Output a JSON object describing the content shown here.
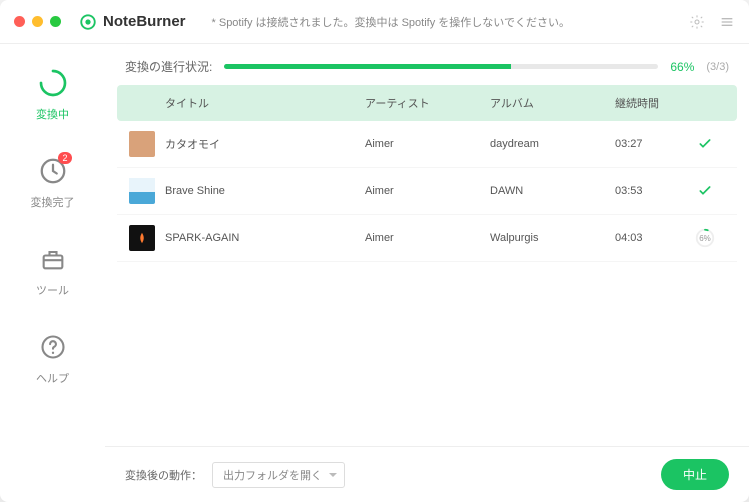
{
  "app": {
    "name": "NoteBurner"
  },
  "statusMessage": "* Spotify は接続されました。変換中は Spotify を操作しないでください。",
  "sidebar": {
    "items": [
      {
        "label": "変換中",
        "icon": "converting",
        "active": true
      },
      {
        "label": "変換完了",
        "icon": "done",
        "badge": "2"
      },
      {
        "label": "ツール",
        "icon": "tools"
      },
      {
        "label": "ヘルプ",
        "icon": "help"
      }
    ]
  },
  "progress": {
    "label": "変換の進行状況:",
    "percent": 66,
    "percentText": "66%",
    "countText": "(3/3)"
  },
  "table": {
    "headers": {
      "title": "タイトル",
      "artist": "アーティスト",
      "album": "アルバム",
      "duration": "継続時間"
    },
    "rows": [
      {
        "title": "カタオモイ",
        "artist": "Aimer",
        "album": "daydream",
        "duration": "03:27",
        "status": "done",
        "thumb": "#d9a27a"
      },
      {
        "title": "Brave Shine",
        "artist": "Aimer",
        "album": "DAWN",
        "duration": "03:53",
        "status": "done",
        "thumb": "#4aa8d8"
      },
      {
        "title": "SPARK-AGAIN",
        "artist": "Aimer",
        "album": "Walpurgis",
        "duration": "04:03",
        "status": "progress",
        "progressText": "6%",
        "thumb": "#111111"
      }
    ]
  },
  "footer": {
    "label": "変換後の動作：",
    "selected": "出力フォルダを開く",
    "stop": "中止"
  }
}
